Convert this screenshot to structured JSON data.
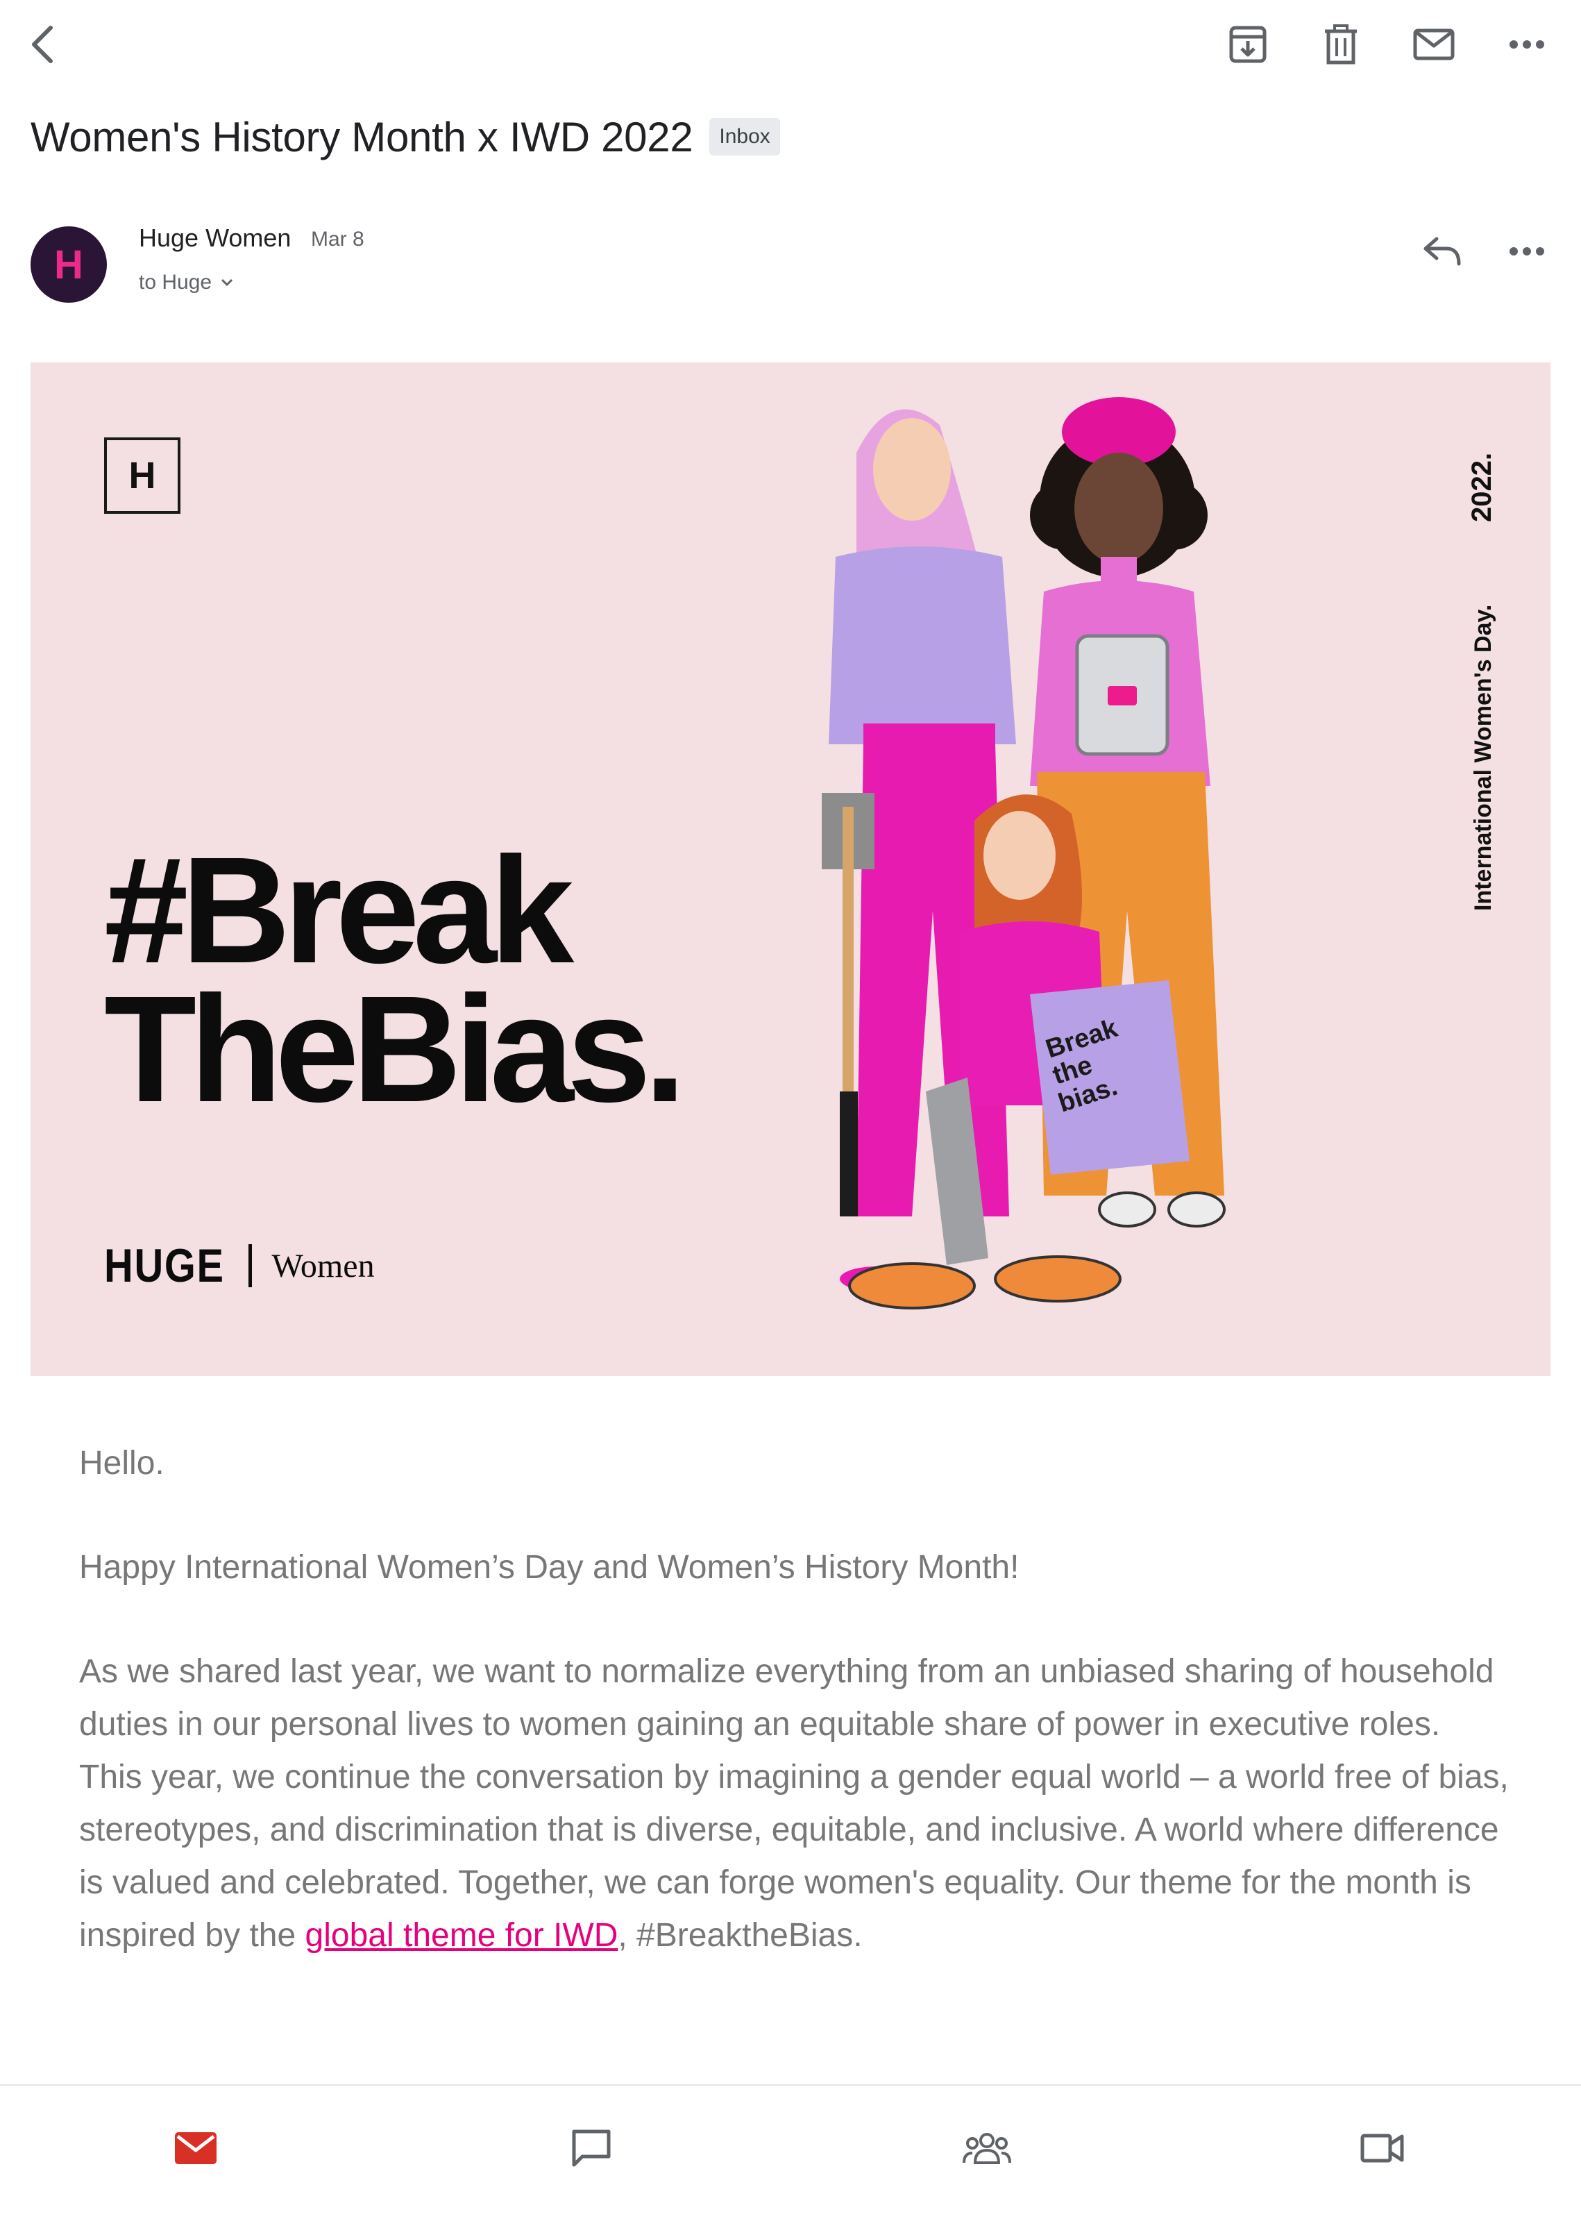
{
  "email": {
    "subject": "Women's History Month x IWD 2022",
    "label": "Inbox",
    "sender": {
      "initial": "H",
      "name": "Huge Women",
      "date": "Mar 8",
      "recipient": "to Huge"
    }
  },
  "banner": {
    "logo_letter": "H",
    "headline_line1": "#Break",
    "headline_line2": "TheBias.",
    "brand_name": "HUGE",
    "brand_sub": "Women",
    "vertical_title": "International Women's Day.",
    "vertical_year": "2022.",
    "bag_text": [
      "Break",
      "the",
      "bias."
    ]
  },
  "body": {
    "greeting": "Hello.",
    "line2": "Happy International Women’s Day and Women’s History Month!",
    "paragraph_before_link": "As we shared last year, we want to normalize everything from an unbiased sharing of household duties in our personal lives to women gaining an equitable share of power in executive roles. This year, we continue the conversation by imagining a gender equal world – a world free of bias, stereotypes, and discrimination that is diverse, equitable, and inclusive. A world where difference is valued and celebrated. Together, we can forge women's equality. Our theme for the month is inspired by the ",
    "link_text": "global theme for IWD",
    "paragraph_after_link": ", #BreaktheBias."
  },
  "colors": {
    "banner_bg": "#f4dfe2",
    "link": "#e6007e",
    "avatar_bg": "#2a1536",
    "avatar_fg": "#ec2a8a",
    "mail_active": "#d93025"
  },
  "icons": {
    "toolbar": [
      "back-arrow-icon",
      "archive-icon",
      "trash-icon",
      "mark-unread-icon",
      "more-horizontal-icon"
    ],
    "message": [
      "reply-icon",
      "more-horizontal-icon"
    ],
    "bottom_nav": [
      "mail-icon",
      "chat-icon",
      "spaces-icon",
      "meet-icon"
    ]
  }
}
